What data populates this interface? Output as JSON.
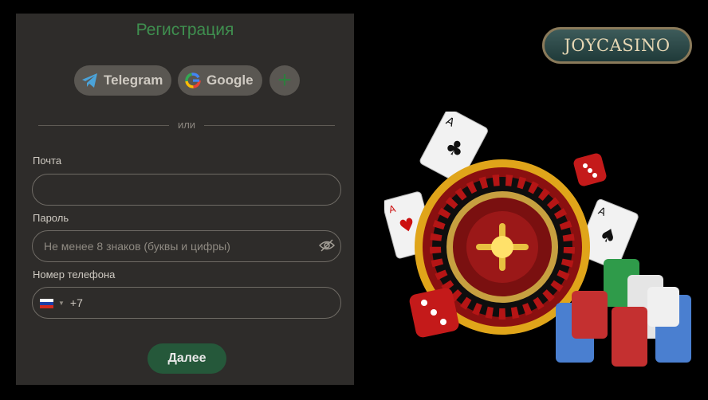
{
  "form": {
    "title": "Регистрация",
    "social": {
      "telegram_label": "Telegram",
      "google_label": "Google",
      "more_label": "+"
    },
    "divider_text": "или",
    "email": {
      "label": "Почта",
      "value": "",
      "placeholder": ""
    },
    "password": {
      "label": "Пароль",
      "placeholder": "Не менее 8 знаков (буквы и цифры)"
    },
    "phone": {
      "label": "Номер телефона",
      "prefix": "+7",
      "country": "RU"
    },
    "submit_label": "Далее"
  },
  "brand": {
    "logo_text": "JOYCASINO"
  },
  "colors": {
    "accent_green": "#3f8f4f",
    "button_green": "#25583a",
    "panel_bg": "#2e2c2a"
  }
}
